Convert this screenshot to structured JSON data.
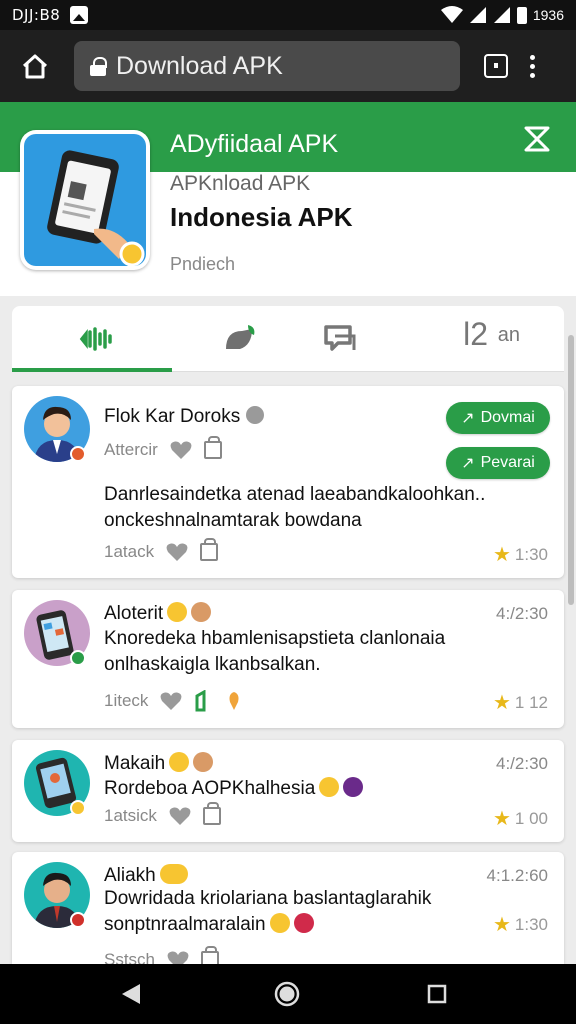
{
  "status_bar": {
    "time": "DJJ:B8",
    "right_time": "1936"
  },
  "browser": {
    "url_text": "Download APK"
  },
  "header": {
    "green_title": "ADyfiidaal APK"
  },
  "app": {
    "subtitle": "APKnload APK",
    "name": "Indonesia APK",
    "extra": "Pndiech"
  },
  "tabs": {
    "label_2": "an",
    "num": "l2"
  },
  "reviews": [
    {
      "name": "Flok Kar Doroks",
      "meta_label": "Attercir",
      "body": "Danrlesaindetka atenad laeabandkaloohkan..\nonckeshnalnamtarak bowdana",
      "footer_label": "1atack",
      "rating": "1:30",
      "btn1": "Dovmai",
      "btn2": "Pevarai"
    },
    {
      "name": "Aloterit",
      "time": "4:/2:30",
      "body": "Knoredeka hbamlenisapstieta clanlonaia\nonlhaskaigla lkanbsalkan.",
      "footer_label": "1iteck",
      "rating": "1 12"
    },
    {
      "name": "Makaih",
      "time": "4:/2:30",
      "body": "Rordeboa AOPKhalhesia",
      "footer_label": "1atsick",
      "rating": "1 00"
    },
    {
      "name": "Aliakh",
      "time": "4:1.2:60",
      "body": "Dowridada kriolariana baslantaglarahik\nsonptnraalmaralain",
      "footer_label": "Sstsch",
      "rating": "1:30"
    }
  ],
  "colors": {
    "green": "#2a9d48",
    "star": "#e8b81a"
  }
}
